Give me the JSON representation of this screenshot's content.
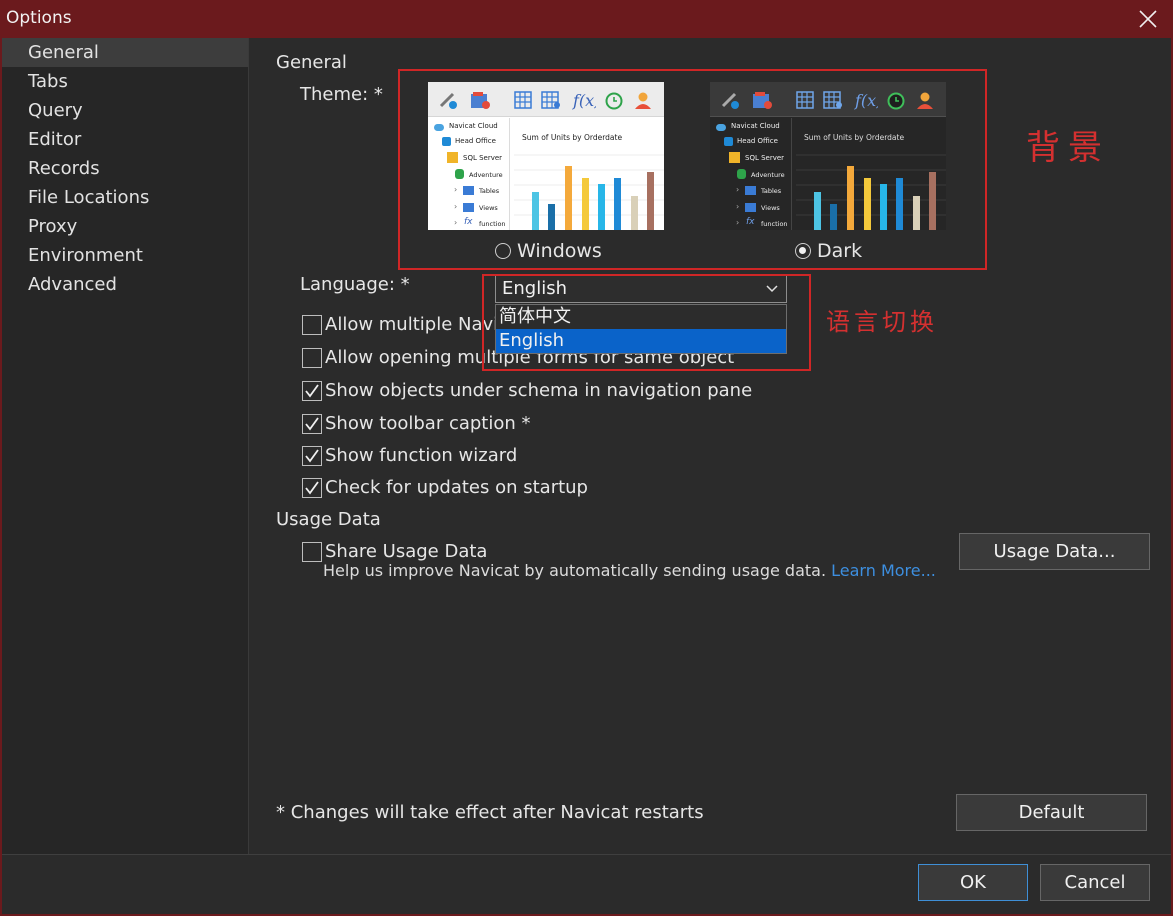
{
  "window": {
    "title": "Options"
  },
  "sidebar": {
    "items": [
      {
        "label": "General",
        "active": true
      },
      {
        "label": "Tabs"
      },
      {
        "label": "Query"
      },
      {
        "label": "Editor"
      },
      {
        "label": "Records"
      },
      {
        "label": "File Locations"
      },
      {
        "label": "Proxy"
      },
      {
        "label": "Environment"
      },
      {
        "label": "Advanced"
      }
    ]
  },
  "general": {
    "section_title": "General",
    "theme_label": "Theme: *",
    "themes": [
      {
        "label": "Windows",
        "selected": false
      },
      {
        "label": "Dark",
        "selected": true
      }
    ],
    "preview": {
      "tree": [
        "Navicat Cloud",
        "Head Office",
        "SQL Server",
        "Adventure",
        "Tables",
        "Views",
        "function"
      ],
      "chart_title": "Sum of Units by Orderdate"
    },
    "language_label": "Language: *",
    "language_value": "English",
    "language_options": [
      "简体中文",
      "English"
    ],
    "checkboxes": [
      {
        "label": "Allow multiple Navi",
        "checked": false
      },
      {
        "label": "Allow opening multiple forms for same object",
        "checked": false
      },
      {
        "label": "Show objects under schema in navigation pane",
        "checked": true
      },
      {
        "label": "Show toolbar caption *",
        "checked": true
      },
      {
        "label": "Show function wizard",
        "checked": true
      },
      {
        "label": "Check for updates on startup",
        "checked": true
      }
    ]
  },
  "annotations": {
    "background": "背景",
    "language_switch": "语言切换"
  },
  "usage": {
    "section_title": "Usage Data",
    "share_label": "Share Usage Data",
    "share_checked": false,
    "help_text": "Help us improve Navicat by automatically sending usage data.",
    "learn_more": "Learn More...",
    "button": "Usage Data..."
  },
  "note": "* Changes will take effect after Navicat restarts",
  "buttons": {
    "default": "Default",
    "ok": "OK",
    "cancel": "Cancel"
  },
  "colors": {
    "accent": "#0a63c9",
    "annotation": "#d02626",
    "titlebar": "#6b1a1d",
    "link": "#3d8fe0"
  }
}
